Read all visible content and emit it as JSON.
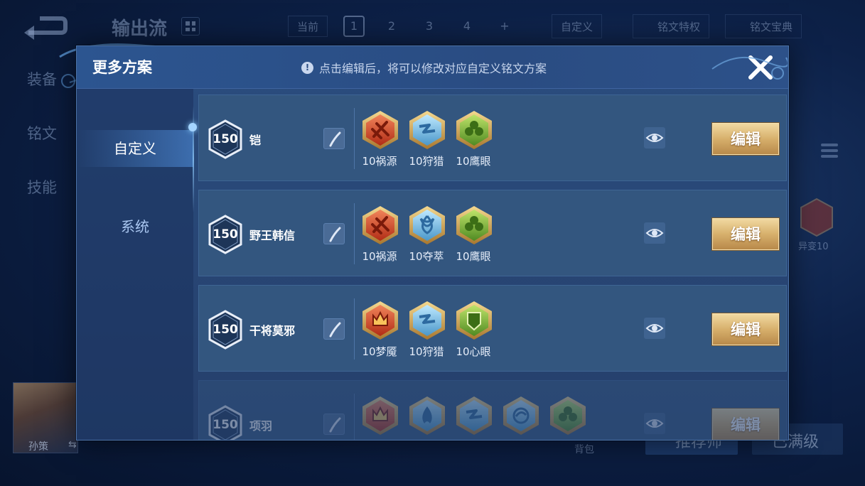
{
  "background": {
    "title": "输出流",
    "current_label": "当前",
    "slots": [
      "1",
      "2",
      "3",
      "4",
      "+"
    ],
    "custom_button": "自定义",
    "privilege_button": "铭文特权",
    "codex_button": "铭文宝典",
    "side_tabs": [
      "装备",
      "铭文",
      "技能"
    ],
    "rune_label": "异变10",
    "hero_name": "孙策",
    "bag_label": "背包",
    "recommend_button": "推荐师",
    "max_level_button": "已满级"
  },
  "modal": {
    "title": "更多方案",
    "hint": "点击编辑后，将可以修改对应自定义铭文方案",
    "nav": [
      "自定义",
      "系统"
    ],
    "edit_label": "编辑",
    "rows": [
      {
        "level": "150",
        "hero": "铠",
        "runes": [
          {
            "label": "10祸源",
            "icon": "red-sword-rune"
          },
          {
            "label": "10狩猎",
            "icon": "blue-lightning-rune"
          },
          {
            "label": "10鹰眼",
            "icon": "green-clover-rune"
          }
        ]
      },
      {
        "level": "150",
        "hero": "野王韩信",
        "runes": [
          {
            "label": "10祸源",
            "icon": "red-sword-rune"
          },
          {
            "label": "10夺萃",
            "icon": "blue-knot-rune"
          },
          {
            "label": "10鹰眼",
            "icon": "green-clover-rune"
          }
        ]
      },
      {
        "level": "150",
        "hero": "干将莫邪",
        "runes": [
          {
            "label": "10梦魇",
            "icon": "red-crown-rune"
          },
          {
            "label": "10狩猎",
            "icon": "blue-lightning-rune"
          },
          {
            "label": "10心眼",
            "icon": "green-shield-rune"
          }
        ]
      },
      {
        "level": "150",
        "hero": "项羽",
        "runes": [
          {
            "label": "",
            "icon": "red-crown-rune"
          },
          {
            "label": "",
            "icon": "blue-flame-rune"
          },
          {
            "label": "",
            "icon": "blue-lightning-rune"
          },
          {
            "label": "",
            "icon": "blue-swirl-rune"
          },
          {
            "label": "",
            "icon": "green-clover-rune"
          }
        ]
      }
    ]
  },
  "colors": {
    "red": "#d44a2a",
    "blue": "#6fb7e6",
    "green": "#7ab33c",
    "gold": "#d7b06c"
  }
}
